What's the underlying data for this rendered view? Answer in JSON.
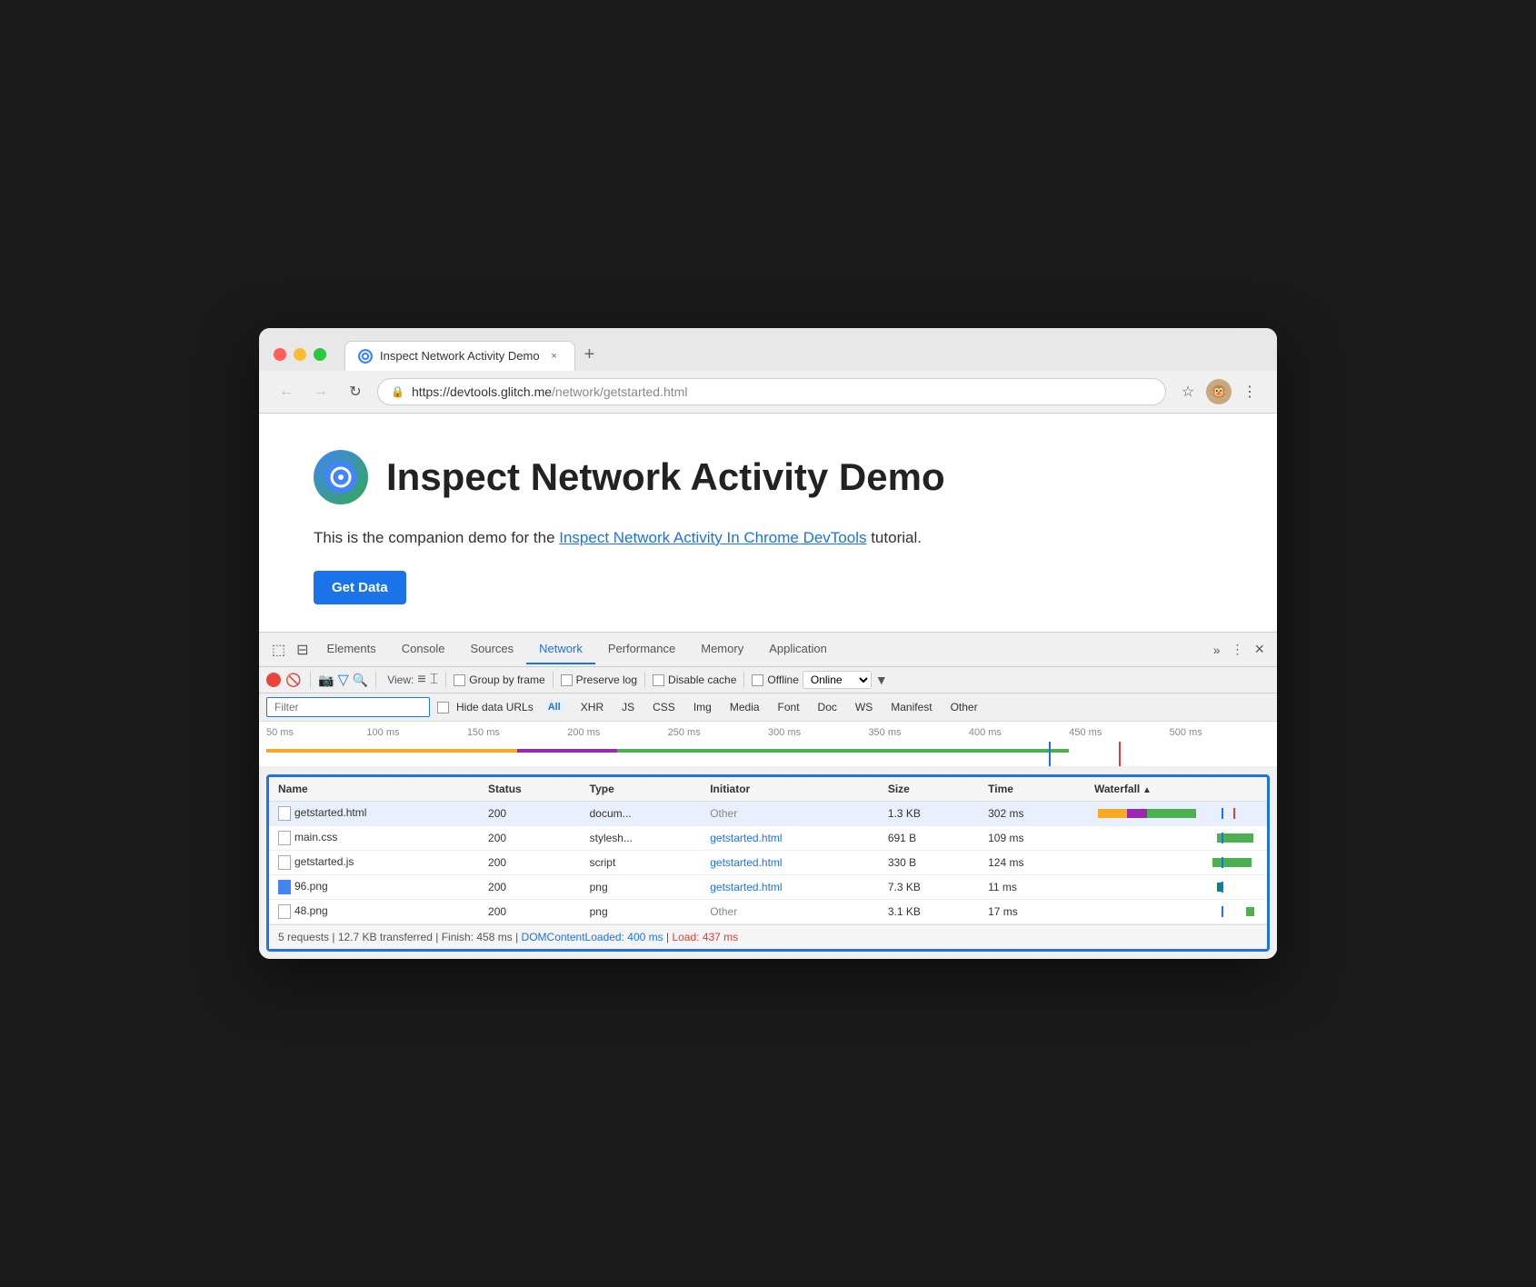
{
  "browser": {
    "traffic_lights": [
      "red",
      "yellow",
      "green"
    ],
    "tab": {
      "favicon_label": "G",
      "title": "Inspect Network Activity Demo",
      "close_label": "×"
    },
    "new_tab_label": "+",
    "nav": {
      "back_label": "←",
      "forward_label": "→",
      "reload_label": "↻"
    },
    "url": {
      "full": "https://devtools.glitch.me/network/getstarted.html",
      "domain": "https://devtools.glitch.me",
      "path": "/network/getstarted.html"
    },
    "toolbar": {
      "bookmark_label": "☆",
      "more_label": "⋮"
    }
  },
  "page": {
    "logo_label": "🔵",
    "title": "Inspect Network Activity Demo",
    "subtitle_prefix": "This is the companion demo for the ",
    "subtitle_link": "Inspect Network Activity In Chrome DevTools",
    "subtitle_suffix": " tutorial.",
    "get_data_label": "Get Data"
  },
  "devtools": {
    "icon_select": "⬚",
    "icon_mobile": "📱",
    "tabs": [
      "Elements",
      "Console",
      "Sources",
      "Network",
      "Performance",
      "Memory",
      "Application"
    ],
    "active_tab": "Network",
    "more_label": "»",
    "more_dots": "⋮",
    "close_label": "×",
    "network": {
      "record_btn": "",
      "stop_btn": "🚫",
      "cam_btn": "📷",
      "filter_btn": "▽",
      "search_btn": "🔍",
      "view_label": "View:",
      "view_list": "≡",
      "view_tree": "⌶",
      "group_by_frame_cb": "",
      "group_by_frame_label": "Group by frame",
      "preserve_log_cb": "",
      "preserve_log_label": "Preserve log",
      "disable_cache_cb": "",
      "disable_cache_label": "Disable cache",
      "offline_cb": "",
      "offline_label": "Offline",
      "online_label": "Online",
      "filter_placeholder": "Filter",
      "hide_data_urls_cb": "",
      "hide_data_urls_label": "Hide data URLs",
      "filter_types": [
        "All",
        "XHR",
        "JS",
        "CSS",
        "Img",
        "Media",
        "Font",
        "Doc",
        "WS",
        "Manifest",
        "Other"
      ]
    },
    "timeline": {
      "labels": [
        "50 ms",
        "100 ms",
        "150 ms",
        "200 ms",
        "250 ms",
        "300 ms",
        "350 ms",
        "400 ms",
        "450 ms",
        "500 ms"
      ]
    },
    "table": {
      "headers": [
        "Name",
        "Status",
        "Type",
        "Initiator",
        "Size",
        "Time",
        "Waterfall"
      ],
      "rows": [
        {
          "name": "getstarted.html",
          "icon_type": "page",
          "status": "200",
          "type": "docum...",
          "initiator": "Other",
          "initiator_link": false,
          "size": "1.3 KB",
          "time": "302 ms",
          "wf_bars": [
            {
              "color": "orange",
              "left": "2%",
              "width": "18%"
            },
            {
              "color": "purple",
              "left": "20%",
              "width": "12%"
            },
            {
              "color": "green",
              "left": "32%",
              "width": "30%"
            }
          ]
        },
        {
          "name": "main.css",
          "icon_type": "page",
          "status": "200",
          "type": "stylesh...",
          "initiator": "getstarted.html",
          "initiator_link": true,
          "size": "691 B",
          "time": "109 ms",
          "wf_bars": [
            {
              "color": "green",
              "left": "75%",
              "width": "22%"
            }
          ]
        },
        {
          "name": "getstarted.js",
          "icon_type": "page",
          "status": "200",
          "type": "script",
          "initiator": "getstarted.html",
          "initiator_link": true,
          "size": "330 B",
          "time": "124 ms",
          "wf_bars": [
            {
              "color": "green",
              "left": "72%",
              "width": "24%"
            }
          ]
        },
        {
          "name": "96.png",
          "icon_type": "blue",
          "status": "200",
          "type": "png",
          "initiator": "getstarted.html",
          "initiator_link": true,
          "size": "7.3 KB",
          "time": "11 ms",
          "wf_bars": [
            {
              "color": "teal",
              "left": "75%",
              "width": "4%"
            }
          ]
        },
        {
          "name": "48.png",
          "icon_type": "page",
          "status": "200",
          "type": "png",
          "initiator": "Other",
          "initiator_link": false,
          "size": "3.1 KB",
          "time": "17 ms",
          "wf_bars": [
            {
              "color": "green",
              "left": "93%",
              "width": "5%"
            }
          ]
        }
      ]
    },
    "status_bar": {
      "requests": "5 requests",
      "transferred": "12.7 KB transferred",
      "finish": "Finish: 458 ms",
      "dom_content_loaded_label": "DOMContentLoaded:",
      "dom_content_loaded_value": "400 ms",
      "load_label": "Load:",
      "load_value": "437 ms",
      "separator": "|"
    }
  }
}
